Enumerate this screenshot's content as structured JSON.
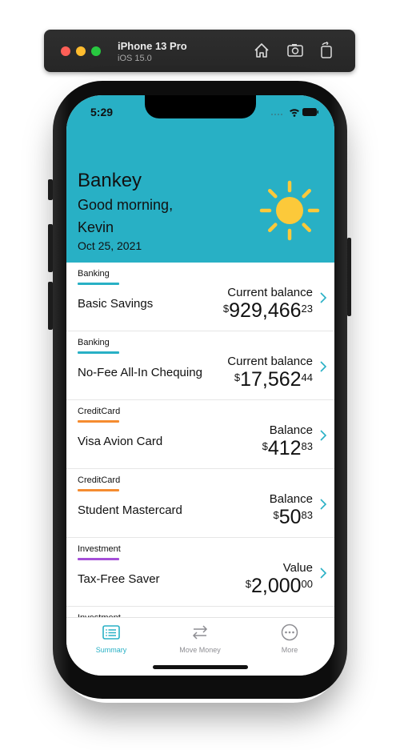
{
  "simulator": {
    "device": "iPhone 13 Pro",
    "os": "iOS 15.0",
    "icons": [
      "home-icon",
      "screenshot-icon",
      "rotate-icon"
    ]
  },
  "status_bar": {
    "time": "5:29"
  },
  "header": {
    "app_title": "Bankey",
    "greeting": "Good morning,",
    "name": "Kevin",
    "date": "Oct 25, 2021",
    "weather_icon": "sun-icon",
    "background": "#28b0c5",
    "sun_color": "#fcc93a"
  },
  "accounts": [
    {
      "type": "Banking",
      "type_color": "#28b0c5",
      "name": "Basic Savings",
      "balance_label": "Current balance",
      "currency": "$",
      "whole": "929,466",
      "cents": "23"
    },
    {
      "type": "Banking",
      "type_color": "#28b0c5",
      "name": "No-Fee All-In Chequing",
      "balance_label": "Current balance",
      "currency": "$",
      "whole": "17,562",
      "cents": "44"
    },
    {
      "type": "CreditCard",
      "type_color": "#f58c30",
      "name": "Visa Avion Card",
      "balance_label": "Balance",
      "currency": "$",
      "whole": "412",
      "cents": "83"
    },
    {
      "type": "CreditCard",
      "type_color": "#f58c30",
      "name": "Student Mastercard",
      "balance_label": "Balance",
      "currency": "$",
      "whole": "50",
      "cents": "83"
    },
    {
      "type": "Investment",
      "type_color": "#a54fd8",
      "name": "Tax-Free Saver",
      "balance_label": "Value",
      "currency": "$",
      "whole": "2,000",
      "cents": "00"
    },
    {
      "type": "Investment"
    }
  ],
  "tab_bar": {
    "tabs": [
      {
        "label": "Summary",
        "icon": "list-icon",
        "selected": true
      },
      {
        "label": "Move Money",
        "icon": "arrows-left-right-icon",
        "selected": false
      },
      {
        "label": "More",
        "icon": "ellipsis-circle-icon",
        "selected": false
      }
    ],
    "active_color": "#28b0c5",
    "inactive_color": "#8e8e93"
  },
  "chevron_color": "#28b0c5"
}
